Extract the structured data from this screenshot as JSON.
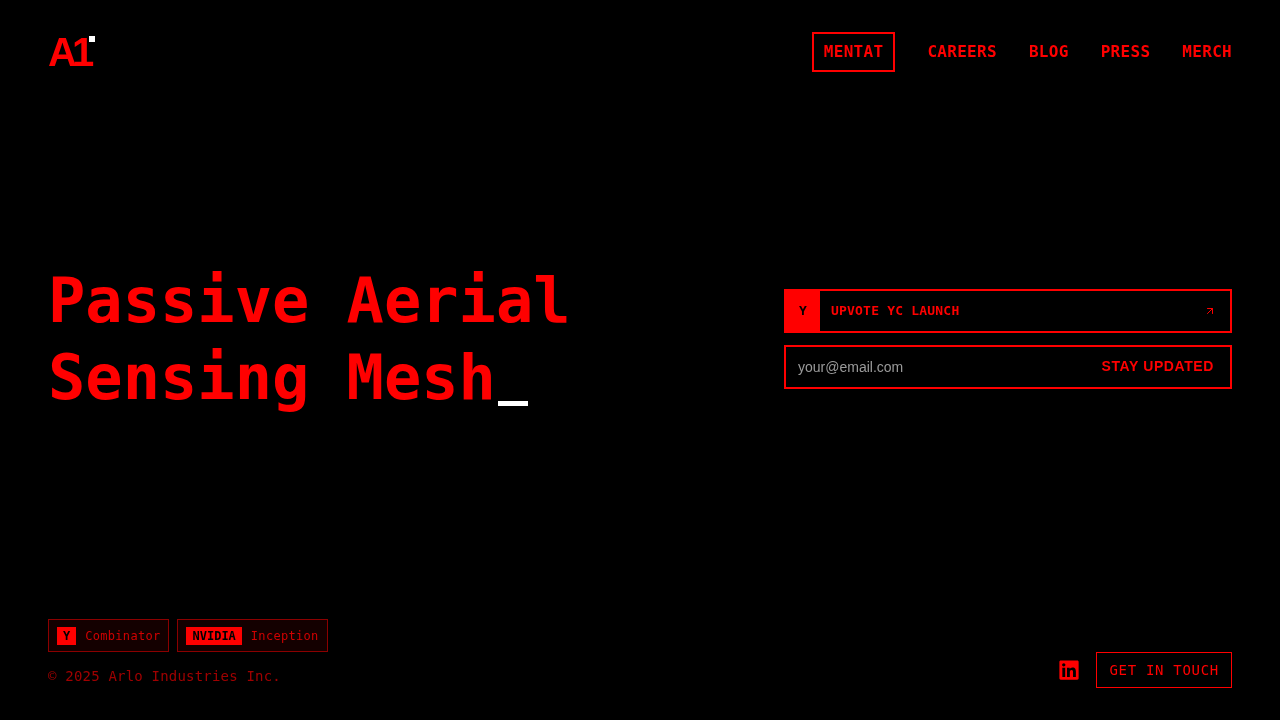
{
  "logo": {
    "text": "A1"
  },
  "nav": [
    {
      "label": "MENTAT",
      "selected": true
    },
    {
      "label": "CAREERS",
      "selected": false
    },
    {
      "label": "BLOG",
      "selected": false
    },
    {
      "label": "PRESS",
      "selected": false
    },
    {
      "label": "MERCH",
      "selected": false
    }
  ],
  "hero": {
    "headline_lines": [
      "Passive Aerial",
      "Sensing Mesh"
    ]
  },
  "launch_link": {
    "badge": "Y",
    "label": "UPVOTE YC LAUNCH"
  },
  "signup": {
    "placeholder": "your@email.com",
    "button": "STAY UPDATED"
  },
  "backers": [
    {
      "mark": "Y",
      "name": "Combinator"
    },
    {
      "mark": "NVIDIA",
      "name": "Inception"
    }
  ],
  "copyright": "© 2025 Arlo Industries Inc.",
  "contact_button": "GET IN TOUCH"
}
